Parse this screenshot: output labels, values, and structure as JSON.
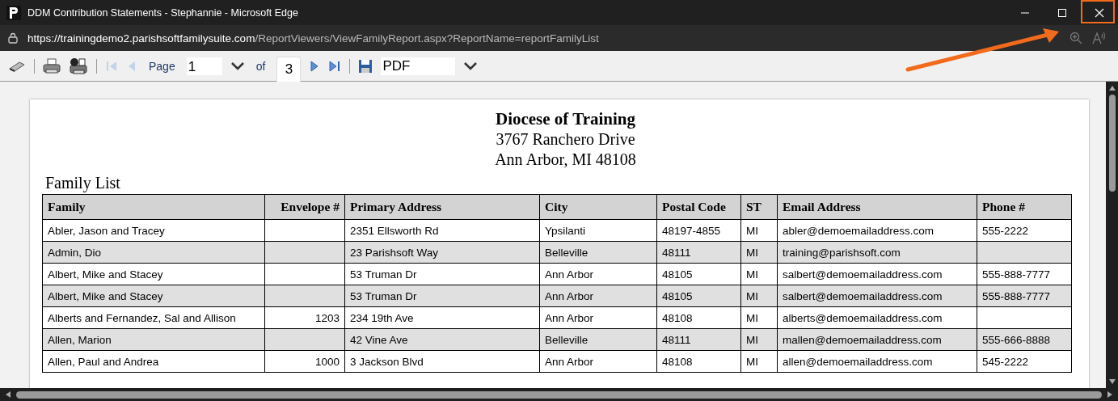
{
  "window": {
    "title": "DDM Contribution Statements - Stephannie - Microsoft Edge"
  },
  "address_bar": {
    "url_host": "https://trainingdemo2.parishsoftfamilysuite.com",
    "url_path": "/ReportViewers/ViewFamilyReport.aspx?ReportName=reportFamilyList"
  },
  "toolbar": {
    "page_label": "Page",
    "page_value": "1",
    "of_label": "of",
    "page_count": "3",
    "export_format": "PDF"
  },
  "report": {
    "title": "Diocese of Training",
    "address_lines": [
      "3767 Ranchero Drive",
      "Ann Arbor, MI 48108"
    ],
    "list_title": "Family List",
    "table": {
      "columns": [
        {
          "label": "Family",
          "kind": "text"
        },
        {
          "label": "Envelope #",
          "kind": "number"
        },
        {
          "label": "Primary Address",
          "kind": "text"
        },
        {
          "label": "City",
          "kind": "text"
        },
        {
          "label": "Postal Code",
          "kind": "text"
        },
        {
          "label": "ST",
          "kind": "text"
        },
        {
          "label": "Email Address",
          "kind": "text"
        },
        {
          "label": "Phone #",
          "kind": "text"
        }
      ],
      "rows": [
        [
          "Abler, Jason and Tracey",
          "",
          "2351 Ellsworth Rd",
          "Ypsilanti",
          "48197-4855",
          "MI",
          "abler@demoemailaddress.com",
          "555-2222"
        ],
        [
          "Admin, Dio",
          "",
          "23 Parishsoft Way",
          "Belleville",
          "48111",
          "MI",
          "training@parishsoft.com",
          ""
        ],
        [
          "Albert, Mike and Stacey",
          "",
          "53 Truman Dr",
          "Ann Arbor",
          "48105",
          "MI",
          "salbert@demoemailaddress.com",
          "555-888-7777"
        ],
        [
          "Albert, Mike and Stacey",
          "",
          "53 Truman Dr",
          "Ann Arbor",
          "48105",
          "MI",
          "salbert@demoemailaddress.com",
          "555-888-7777"
        ],
        [
          "Alberts and Fernandez, Sal and Allison",
          "1203",
          "234 19th Ave",
          "Ann Arbor",
          "48108",
          "MI",
          "alberts@demoemailaddress.com",
          ""
        ],
        [
          "Allen, Marion",
          "",
          "42 Vine Ave",
          "Belleville",
          "48111",
          "MI",
          "mallen@demoemailaddress.com",
          "555-666-8888"
        ],
        [
          "Allen, Paul and Andrea",
          "1000",
          "3 Jackson Blvd",
          "Ann Arbor",
          "48108",
          "MI",
          "allen@demoemailaddress.com",
          "545-2222"
        ]
      ]
    }
  }
}
